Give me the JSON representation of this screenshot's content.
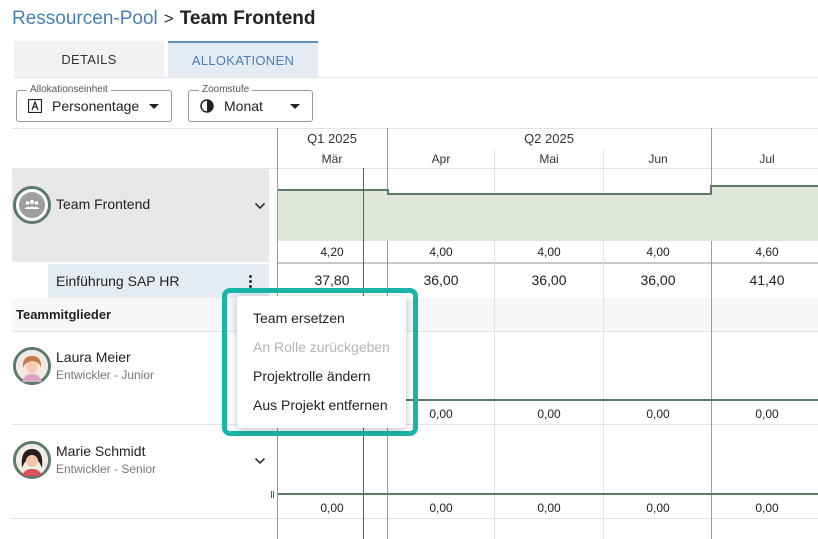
{
  "breadcrumb": {
    "parent": "Ressourcen-Pool",
    "separator": ">",
    "current": "Team Frontend"
  },
  "tabs": [
    {
      "label": "DETAILS",
      "active": false
    },
    {
      "label": "ALLOKATIONEN",
      "active": true
    }
  ],
  "filters": {
    "unit": {
      "legend": "Allokationseinheit",
      "value": "Personentage",
      "icon": "letter-a-icon"
    },
    "zoom": {
      "legend": "Zoomstufe",
      "value": "Monat",
      "icon": "half-circle-icon"
    }
  },
  "timeline": {
    "quarters": [
      "Q1 2025",
      "Q2 2025"
    ],
    "months": [
      "Mär",
      "Apr",
      "Mai",
      "Jun",
      "Jul"
    ]
  },
  "team": {
    "name": "Team Frontend",
    "avatar_icon": "group-icon",
    "capacity_values": [
      "4,20",
      "4,00",
      "4,00",
      "4,00",
      "4,60"
    ],
    "assignment": {
      "name": "Einführung SAP HR",
      "values": [
        "37,80",
        "36,00",
        "36,00",
        "36,00",
        "41,40"
      ]
    }
  },
  "members_section": {
    "title": "Teammitglieder"
  },
  "members": [
    {
      "name": "Laura Meier",
      "role": "Entwickler - Junior",
      "values": [
        "0,00",
        "0,00",
        "0,00",
        "0,00"
      ]
    },
    {
      "name": "Marie Schmidt",
      "role": "Entwickler - Senior",
      "values": [
        "0,00",
        "0,00",
        "0,00",
        "0,00",
        "0,00"
      ]
    }
  ],
  "context_menu": {
    "items": [
      {
        "label": "Team ersetzen",
        "disabled": false
      },
      {
        "label": "An Rolle zurückgeben",
        "disabled": true
      },
      {
        "label": "Projektrolle ändern",
        "disabled": false
      },
      {
        "label": "Aus Projekt entfernen",
        "disabled": false
      }
    ]
  },
  "colors": {
    "accent": "#4a7fb5",
    "capacity_fill": "#dfe8d8",
    "capacity_line": "#5a7a6a",
    "today_line": "#c0392b",
    "menu_highlight": "#1bb5a8"
  }
}
